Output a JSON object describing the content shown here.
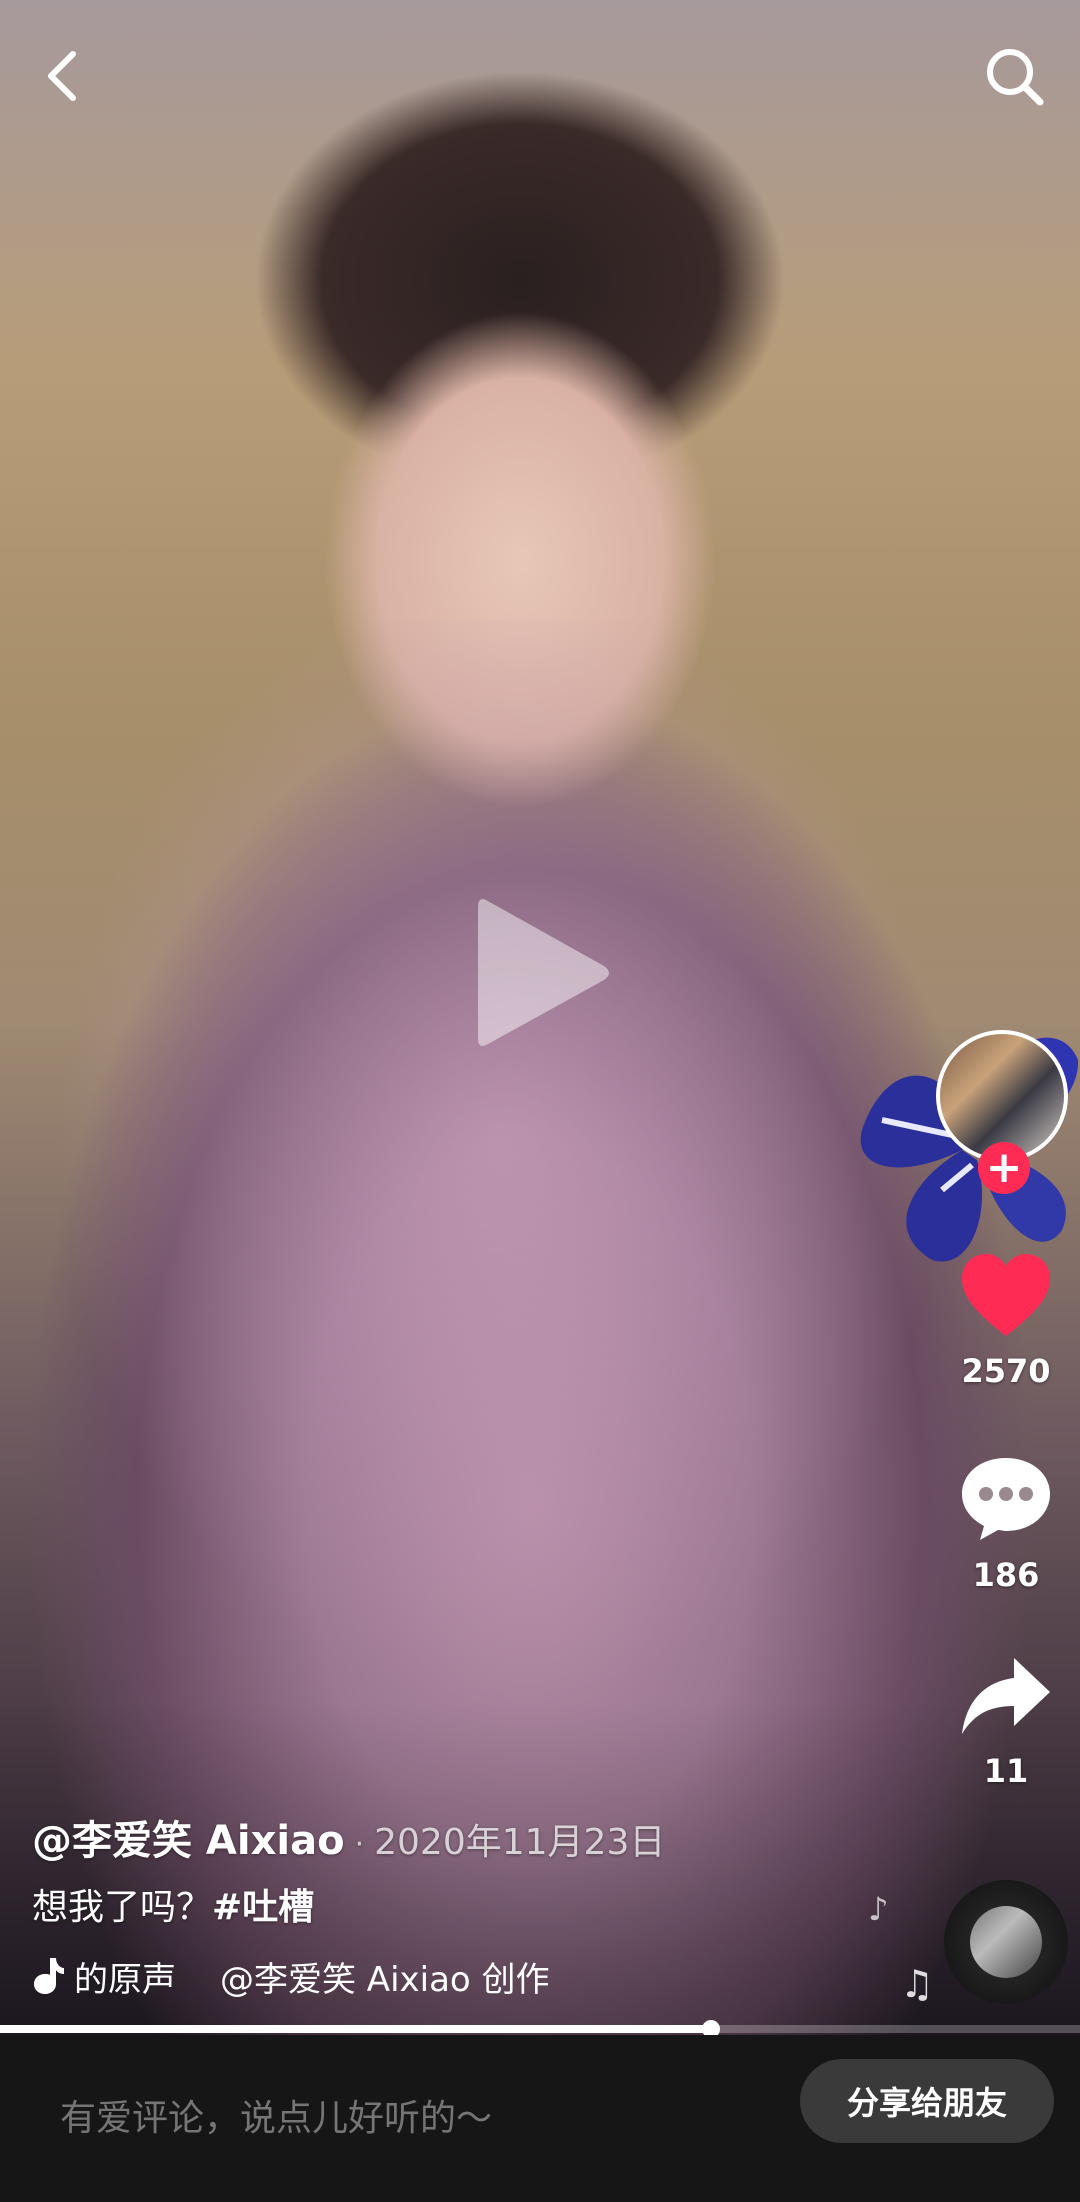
{
  "author": {
    "handle": "@李爱笑 Aixiao",
    "separator": "·",
    "date": "2020年11月23日"
  },
  "caption": {
    "text": "想我了吗？",
    "hashtag": "#吐槽"
  },
  "music": {
    "segments": [
      "的原声",
      "@李爱笑 Aixiao 创作"
    ]
  },
  "actions": {
    "likes": "2570",
    "comments": "186",
    "shares": "11"
  },
  "playback": {
    "progress": 0.658,
    "state": "paused"
  },
  "comment_bar": {
    "placeholder": "有爱评论，说点儿好听的～",
    "share_label": "分享给朋友"
  },
  "colors": {
    "like": "#fe2c55",
    "follow": "#fe2c55",
    "bar_bg": "#161616",
    "button_bg": "#3a3a3a"
  },
  "icons": {
    "back": "back-icon",
    "search": "search-icon",
    "play": "play-icon",
    "like": "heart-icon",
    "comment": "comment-icon",
    "share": "share-icon",
    "music": "music-note-icon"
  }
}
